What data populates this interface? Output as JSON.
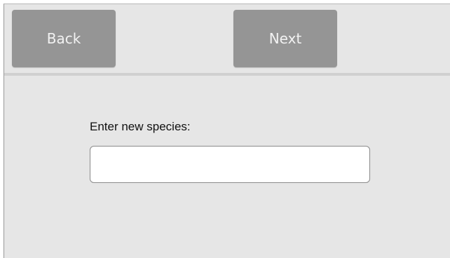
{
  "toolbar": {
    "back_label": "Back",
    "next_label": "Next"
  },
  "form": {
    "species_label": "Enter new species:",
    "species_value": "",
    "species_placeholder": ""
  }
}
